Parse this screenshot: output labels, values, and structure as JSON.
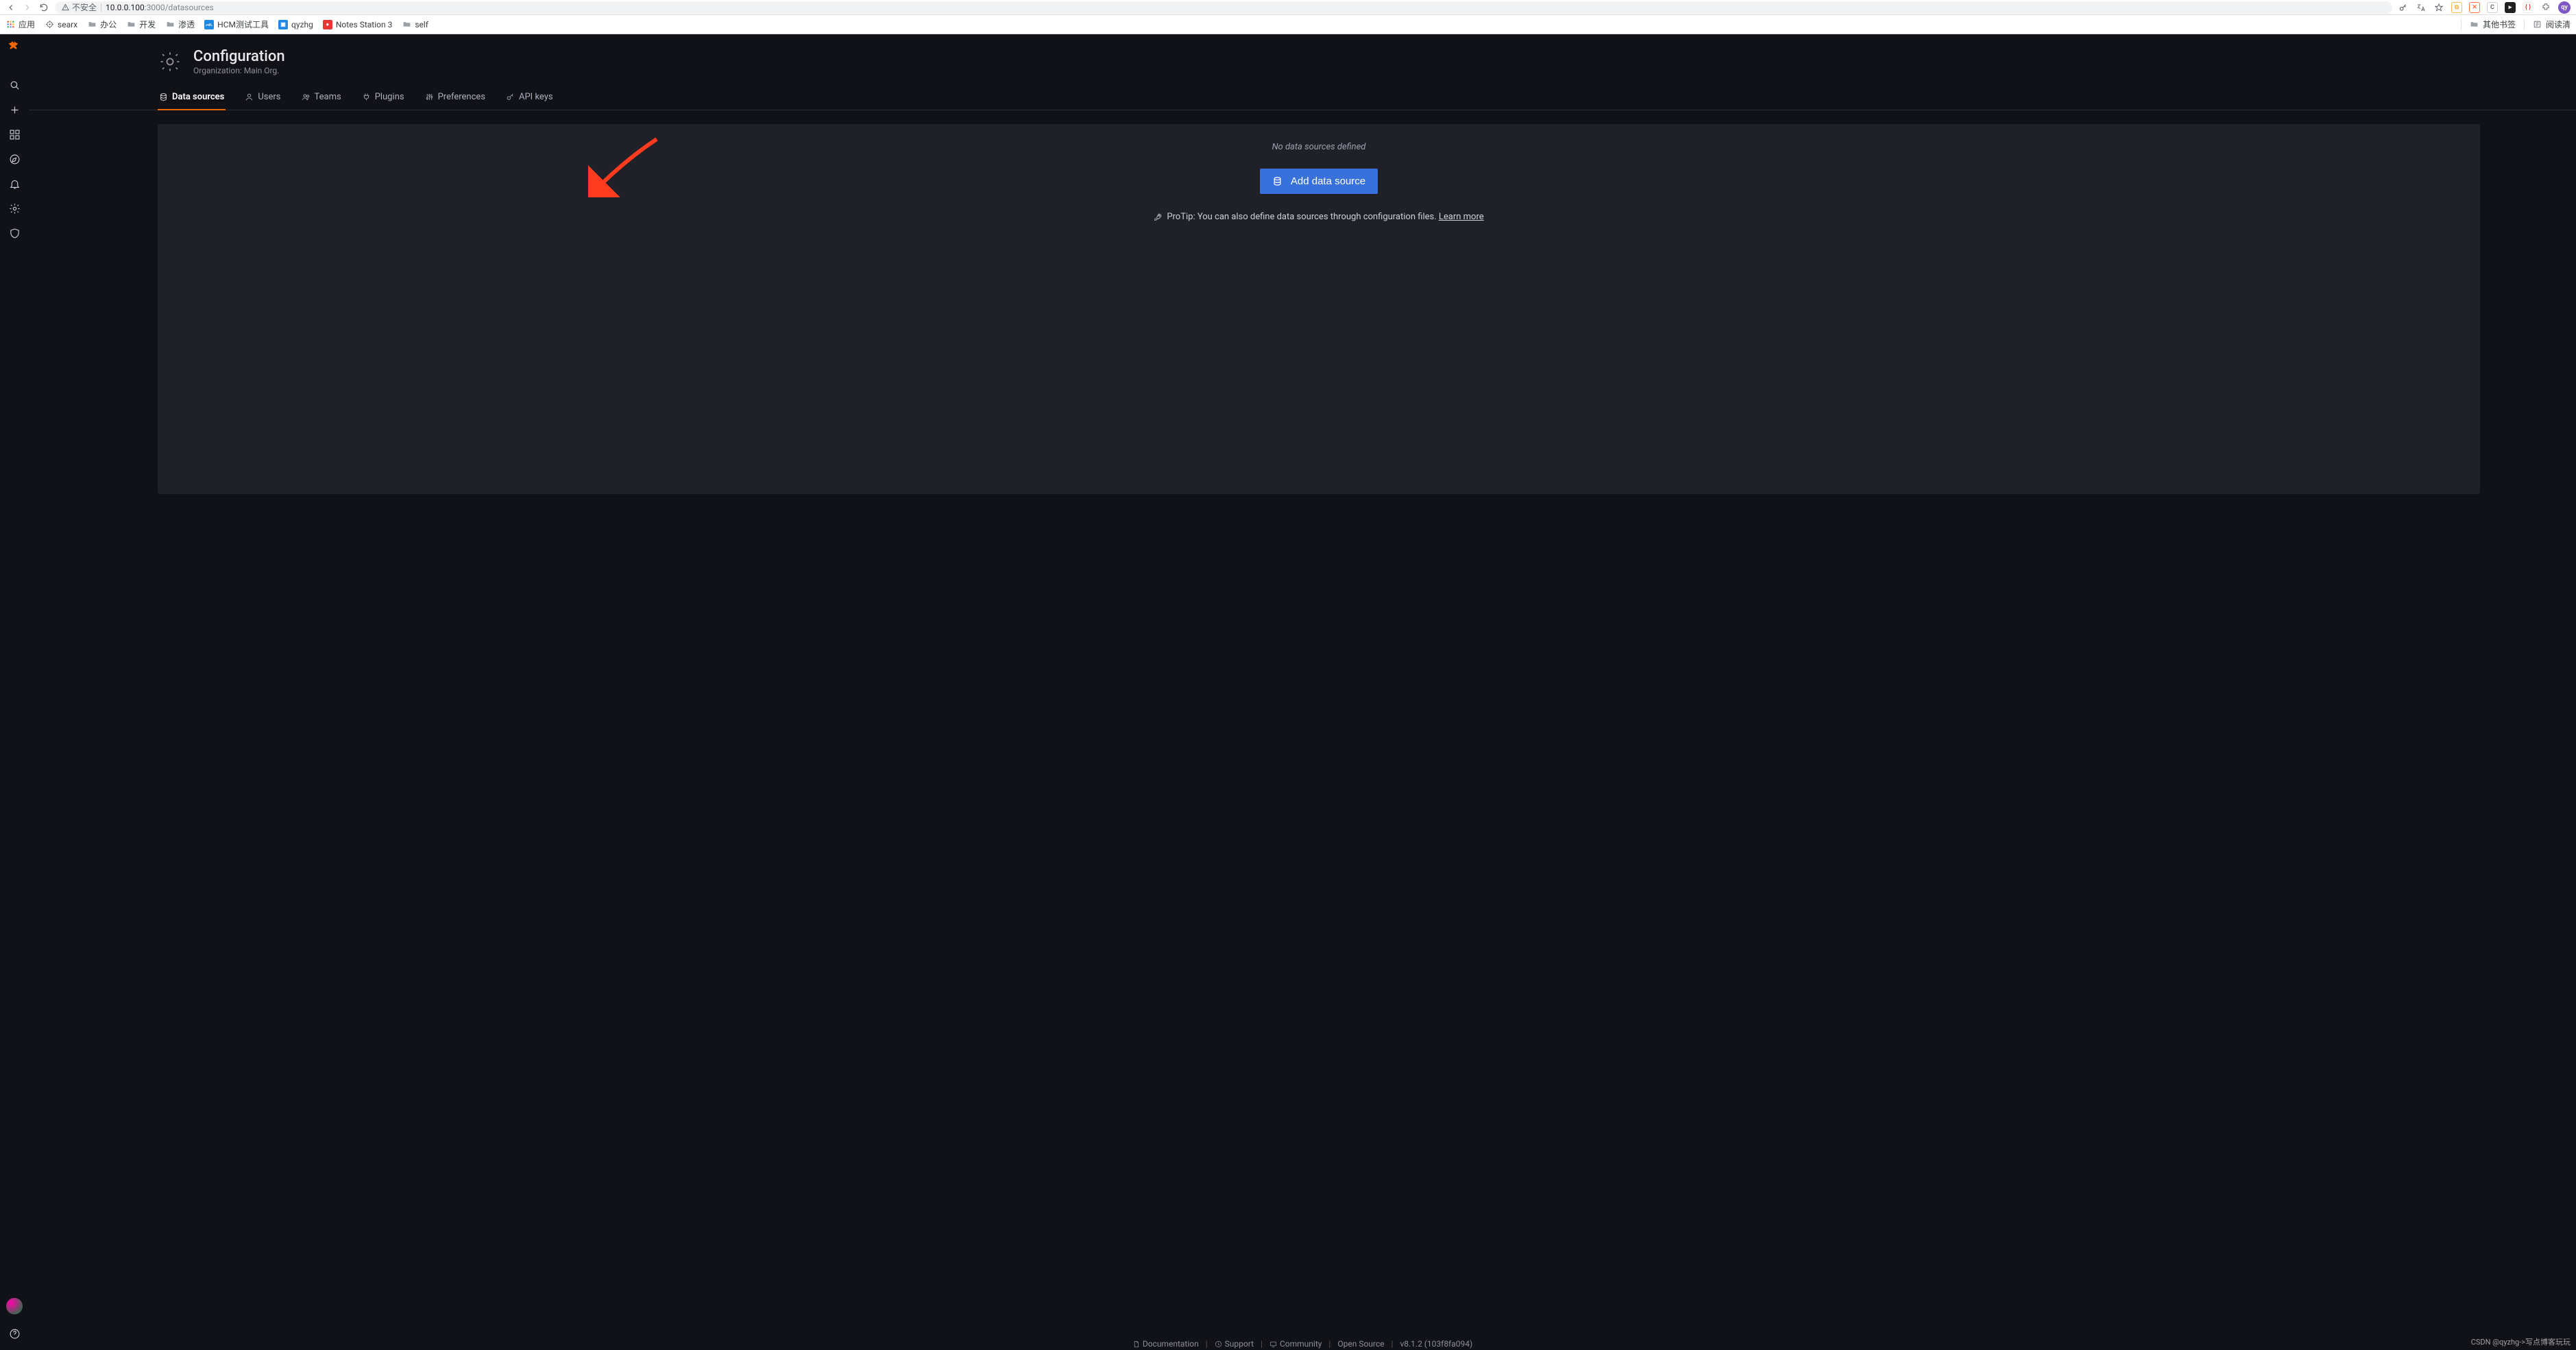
{
  "browser": {
    "insecure_label": "不安全",
    "url_host": "10.0.0.100",
    "url_rest": ":3000/datasources",
    "avatar_initials": "qy",
    "ext_cx": "C",
    "ext_braces": "{ }",
    "bookmarks": [
      {
        "label": "应用",
        "kind": "apps"
      },
      {
        "label": "searx",
        "kind": "target"
      },
      {
        "label": "办公",
        "kind": "folder"
      },
      {
        "label": "开发",
        "kind": "folder"
      },
      {
        "label": "渗透",
        "kind": "folder"
      },
      {
        "label": "HCM测试工具",
        "kind": "tile",
        "bg": "#1e88e5",
        "glyph": "ᨒ"
      },
      {
        "label": "qyzhg",
        "kind": "tile",
        "bg": "#1e88e5",
        "glyph": "▣"
      },
      {
        "label": "Notes Station 3",
        "kind": "tile",
        "bg": "#e53935",
        "glyph": "●"
      },
      {
        "label": "self",
        "kind": "folder"
      }
    ],
    "right_bm_other": "其他书签",
    "right_bm_read": "阅读清"
  },
  "page": {
    "title": "Configuration",
    "subtitle": "Organization: Main Org.",
    "tabs": [
      {
        "id": "datasources",
        "label": "Data sources",
        "icon": "database",
        "active": true
      },
      {
        "id": "users",
        "label": "Users",
        "icon": "user"
      },
      {
        "id": "teams",
        "label": "Teams",
        "icon": "users"
      },
      {
        "id": "plugins",
        "label": "Plugins",
        "icon": "plug"
      },
      {
        "id": "preferences",
        "label": "Preferences",
        "icon": "sliders"
      },
      {
        "id": "apikeys",
        "label": "API keys",
        "icon": "key"
      }
    ],
    "empty_text": "No data sources defined",
    "add_button_label": "Add data source",
    "protip_prefix": "ProTip: You can also define data sources through configuration files. ",
    "protip_link": "Learn more"
  },
  "footer": {
    "items": [
      {
        "label": "Documentation",
        "icon": "doc"
      },
      {
        "label": "Support",
        "icon": "support"
      },
      {
        "label": "Community",
        "icon": "community"
      },
      {
        "label": "Open Source",
        "icon": ""
      }
    ],
    "version": "v8.1.2 (103f8fa094)"
  },
  "watermark": "CSDN @qyzhg->写点博客玩玩"
}
